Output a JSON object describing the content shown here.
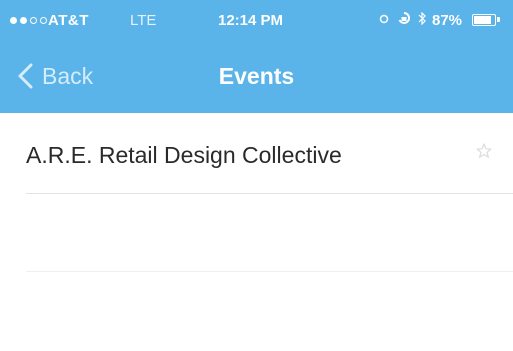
{
  "status_bar": {
    "carrier": "AT&T",
    "network": "LTE",
    "time": "12:14 PM",
    "battery_text": "87%",
    "battery_level": 0.87
  },
  "nav": {
    "back_label": "Back",
    "title": "Events"
  },
  "events": [
    {
      "title": "A.R.E. Retail Design Collective"
    }
  ],
  "colors": {
    "header": "#5ab4ea",
    "text": "#2a2a2a",
    "separator": "#e4e4e4"
  },
  "icons": {
    "back": "chevron-left-icon",
    "favorite": "star-icon"
  }
}
